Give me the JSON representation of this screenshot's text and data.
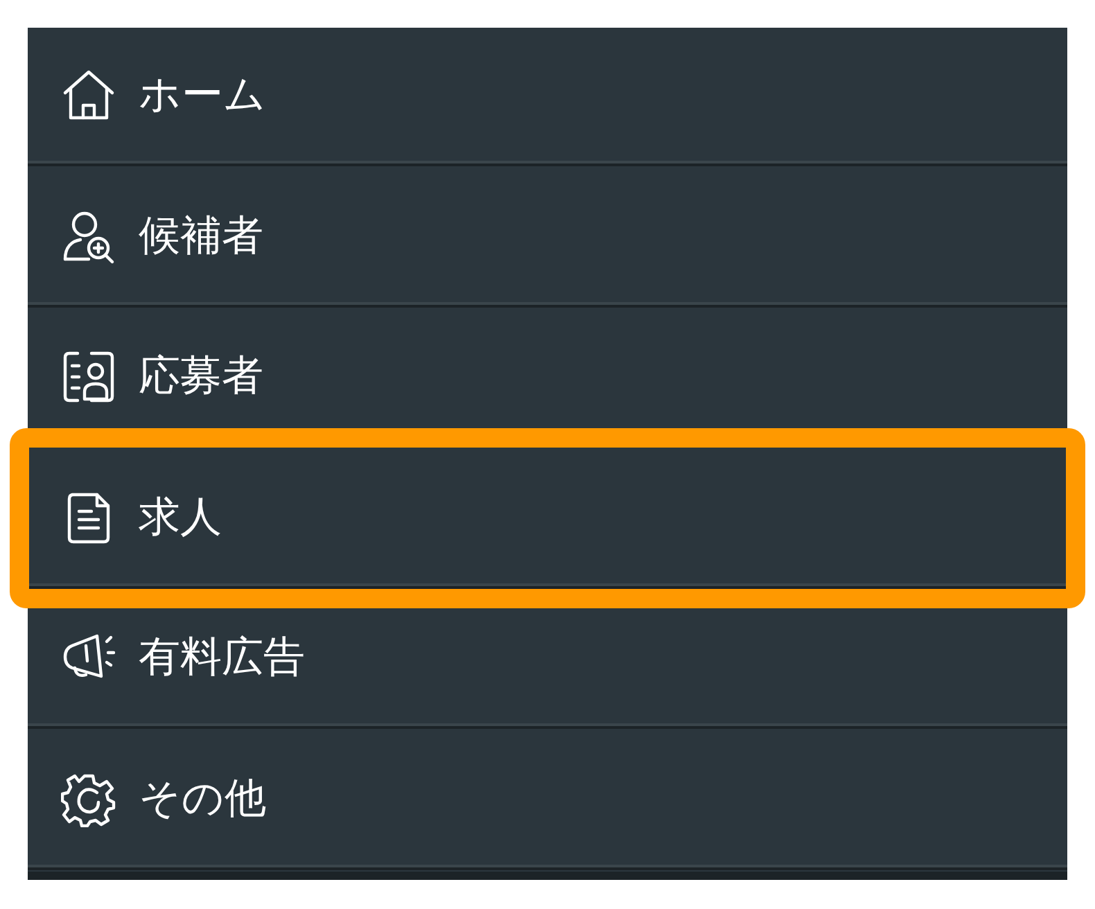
{
  "menu": {
    "items": [
      {
        "kind": "home",
        "label": "ホーム",
        "selected": false
      },
      {
        "kind": "candidates",
        "label": "候補者",
        "selected": false
      },
      {
        "kind": "applicants",
        "label": "応募者",
        "selected": false
      },
      {
        "kind": "jobs",
        "label": "求人",
        "selected": true
      },
      {
        "kind": "ads",
        "label": "有料広告",
        "selected": false
      },
      {
        "kind": "other",
        "label": "その他",
        "selected": false
      }
    ]
  }
}
